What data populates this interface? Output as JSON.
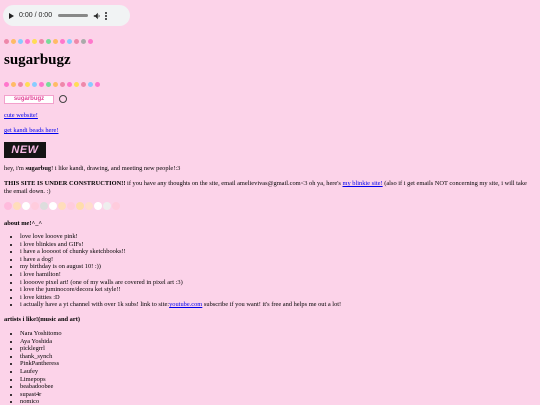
{
  "audio": {
    "time": "0:00 / 0:00"
  },
  "title": "sugarbugz",
  "badge": "sugarbugz",
  "links": {
    "cute_website": "cute website!",
    "kandi_beads": "get kandi beads here!"
  },
  "new_banner": "NEW",
  "intro": {
    "prefix": "hey, i'm ",
    "name": "sugarbug",
    "suffix": "! i like kandi, drawing, and meeting new people!:3"
  },
  "construction": {
    "heading": "THIS SITE IS UNDER CONSTRUCTION!!",
    "text1": " if you have any thoughts on the site, email amelievivas@gmail.com<3 oh ya, here's ",
    "link": "my blinkie site!",
    "text2": " (also if i get emails NOT concerning my site, i will take the email down. :)"
  },
  "about": {
    "heading": "about me!^_^",
    "items": [
      "love love looove pink!",
      "i love blinkies and GIFs!",
      "i have a looooot of chunky sketchbooks!!",
      "i have a dog!",
      "my birthday is on august 10! :))",
      "i love hamilton!",
      "i loooove pixel art! (one of my walls are covered in pixel art :3)",
      "i love the juminocore/decora kei style!!",
      "i love kitties :D"
    ],
    "yt_prefix": "i actually have a yt channel with over 1k subs! link to site:",
    "yt_link": "youtube.com",
    "yt_suffix": " subscribe if you want! it's free and helps me out a lot!"
  },
  "artists": {
    "heading": "artists i like!(music and art)",
    "items": [
      "Nara Yoshitomo",
      "Aya Yoshida",
      "picklegrrl",
      "thank_synch",
      "PinkPantheress",
      "Laufey",
      "Limepops",
      "beabadoobee",
      "supast4r",
      "nomico"
    ]
  },
  "colors": {
    "background": "#fcd3e9",
    "link": "#0000ee",
    "badge_text": "#e23f95"
  }
}
